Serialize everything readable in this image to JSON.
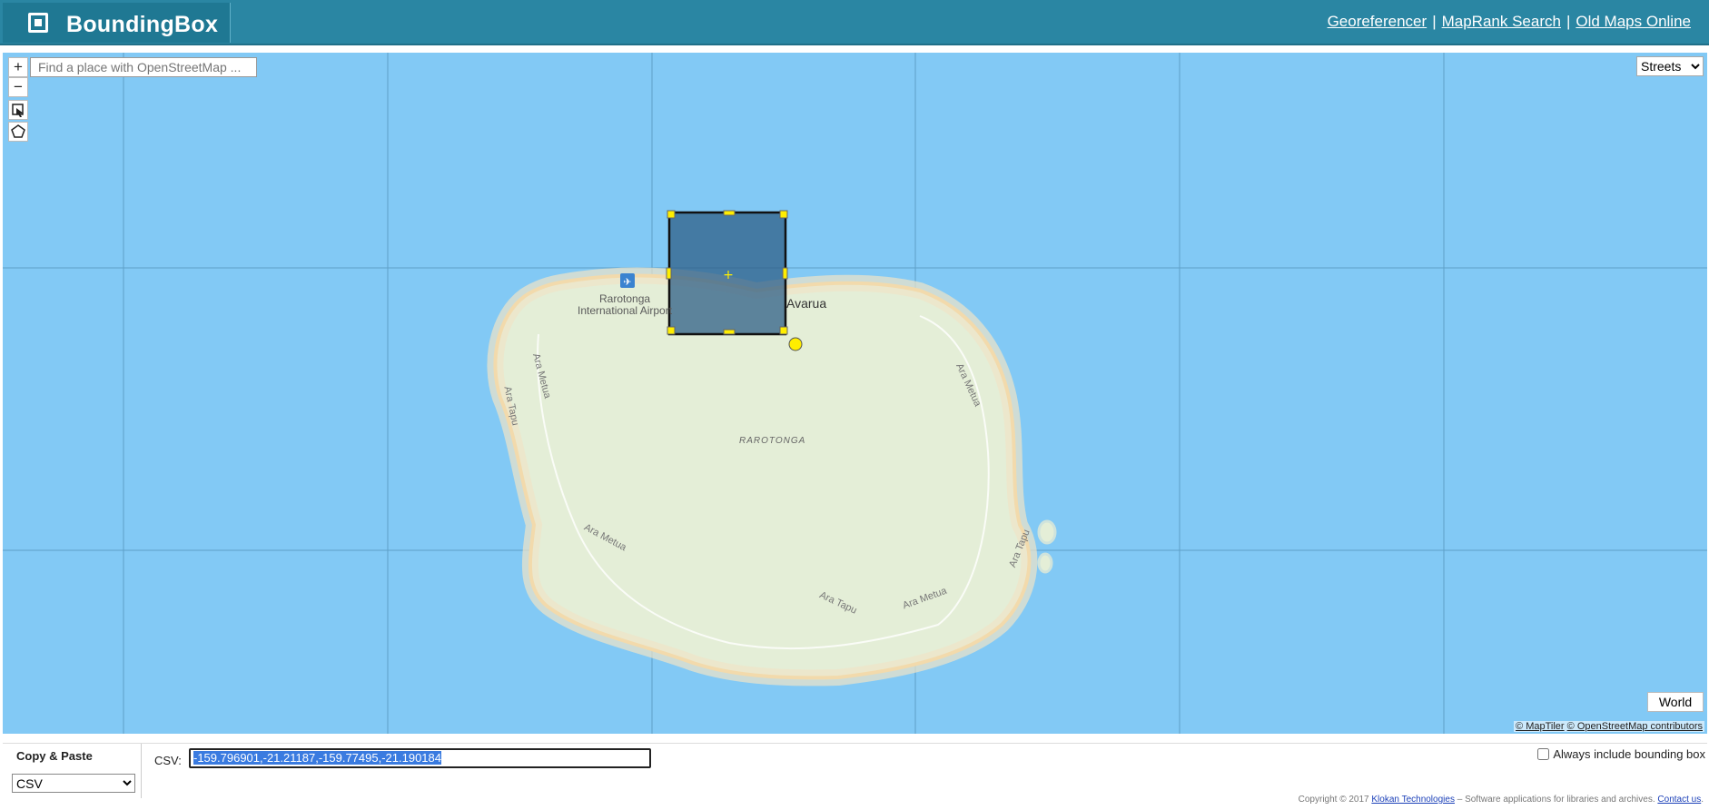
{
  "header": {
    "logo_text": "BoundingBox",
    "links": [
      "Georeferencer",
      "MapRank Search",
      "Old Maps Online"
    ],
    "separator": "|"
  },
  "map": {
    "search_placeholder": "Find a place with OpenStreetMap ...",
    "zoom_in": "+",
    "zoom_out": "−",
    "layer_selected": "Streets",
    "layer_options": [
      "Streets"
    ],
    "world_button": "World",
    "attribution": [
      "© MapTiler",
      "© OpenStreetMap contributors"
    ],
    "labels": {
      "airport": "Rarotonga",
      "airport2": "International Airport",
      "town": "Avarua",
      "island": "RAROTONGA",
      "road1": "Ara Metua",
      "road2": "Ara Tapu"
    },
    "colors": {
      "ocean": "#82c9f5",
      "land": "#e4eed7",
      "box_fill": "#2f5f87",
      "handle": "#ffee00"
    }
  },
  "bottom": {
    "copy_title": "Copy & Paste",
    "format_selected": "CSV",
    "csv_label": "CSV:",
    "csv_value": "-159.796901,-21.21187,-159.77495,-21.190184",
    "include_label": "Always include bounding box",
    "copyright_prefix": "Copyright © 2017",
    "copyright_link": "Klokan Technologies",
    "copyright_middle": "– Software applications for libraries and archives.",
    "contact_link": "Contact us"
  }
}
